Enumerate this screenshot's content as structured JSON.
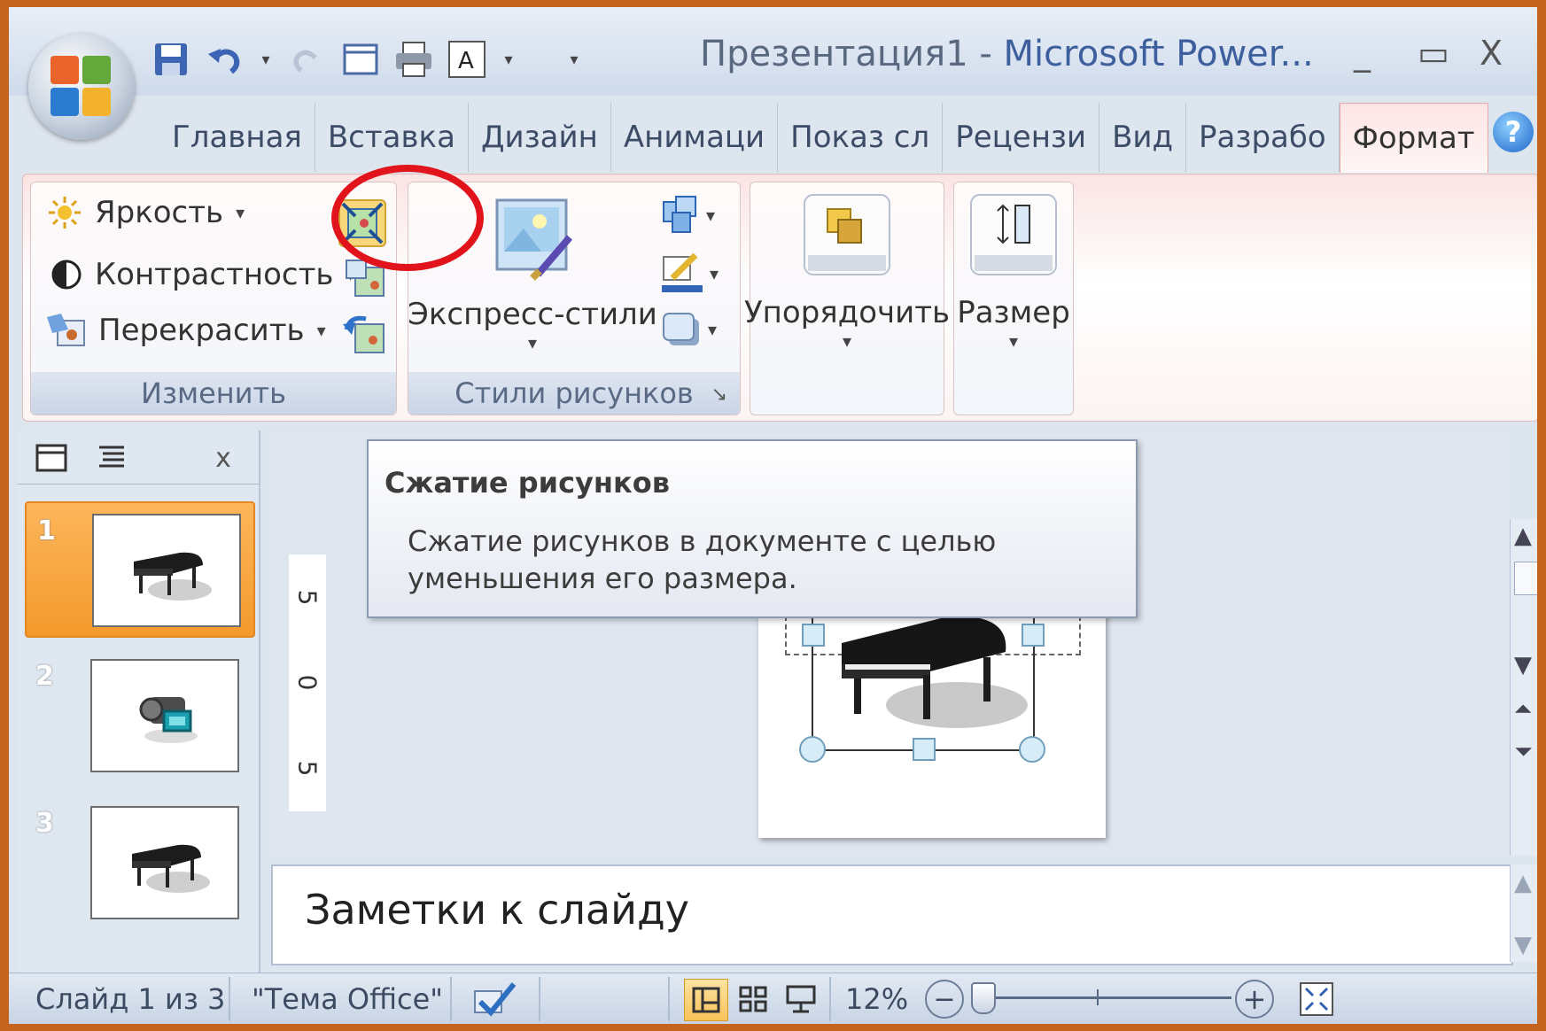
{
  "window": {
    "title_doc": "Презентация1",
    "title_sep": " - ",
    "title_app": "Microsoft Power...",
    "minimize": "_",
    "maximize": "▭",
    "close": "X"
  },
  "tabs": [
    {
      "label": "Главная"
    },
    {
      "label": "Вставка"
    },
    {
      "label": "Дизайн"
    },
    {
      "label": "Анимаци"
    },
    {
      "label": "Показ сл"
    },
    {
      "label": "Рецензи"
    },
    {
      "label": "Вид"
    },
    {
      "label": "Разрабо"
    },
    {
      "label": "Формат",
      "active": true
    }
  ],
  "help": "?",
  "ribbon": {
    "adjust": {
      "brightness": "Яркость",
      "contrast": "Контрастность",
      "recolor": "Перекрасить",
      "label": "Изменить"
    },
    "styles": {
      "quick_styles": "Экспресс-стили",
      "label": "Стили рисунков"
    },
    "arrange": "Упорядочить",
    "size": "Размер"
  },
  "tooltip": {
    "title": "Сжатие рисунков",
    "body": "Сжатие рисунков в документе с целью уменьшения его размера."
  },
  "slides_pane": {
    "close": "x",
    "slides": [
      {
        "number": "1",
        "selected": true
      },
      {
        "number": "2"
      },
      {
        "number": "3"
      }
    ]
  },
  "ruler": [
    "5",
    "0",
    "5"
  ],
  "notes": {
    "placeholder": "Заметки к слайду"
  },
  "status": {
    "slide_info": "Слайд 1 из 3",
    "theme": "\"Тема Office\"",
    "zoom": "12%",
    "zoom_minus": "−",
    "zoom_plus": "+"
  },
  "colors": {
    "highlight": "#e0141a",
    "active_tab": "#fde4e4",
    "selected_slide": "#f39a2c"
  },
  "icons": [
    "office-button-icon",
    "save-icon",
    "undo-icon",
    "redo-icon",
    "print-icon",
    "compress-pictures-icon",
    "brightness-icon",
    "contrast-icon",
    "recolor-icon",
    "change-picture-icon",
    "reset-picture-icon",
    "quick-styles-icon",
    "picture-shape-icon",
    "picture-border-icon",
    "picture-effects-icon",
    "arrange-icon",
    "size-icon",
    "help-icon",
    "spell-check-icon"
  ]
}
